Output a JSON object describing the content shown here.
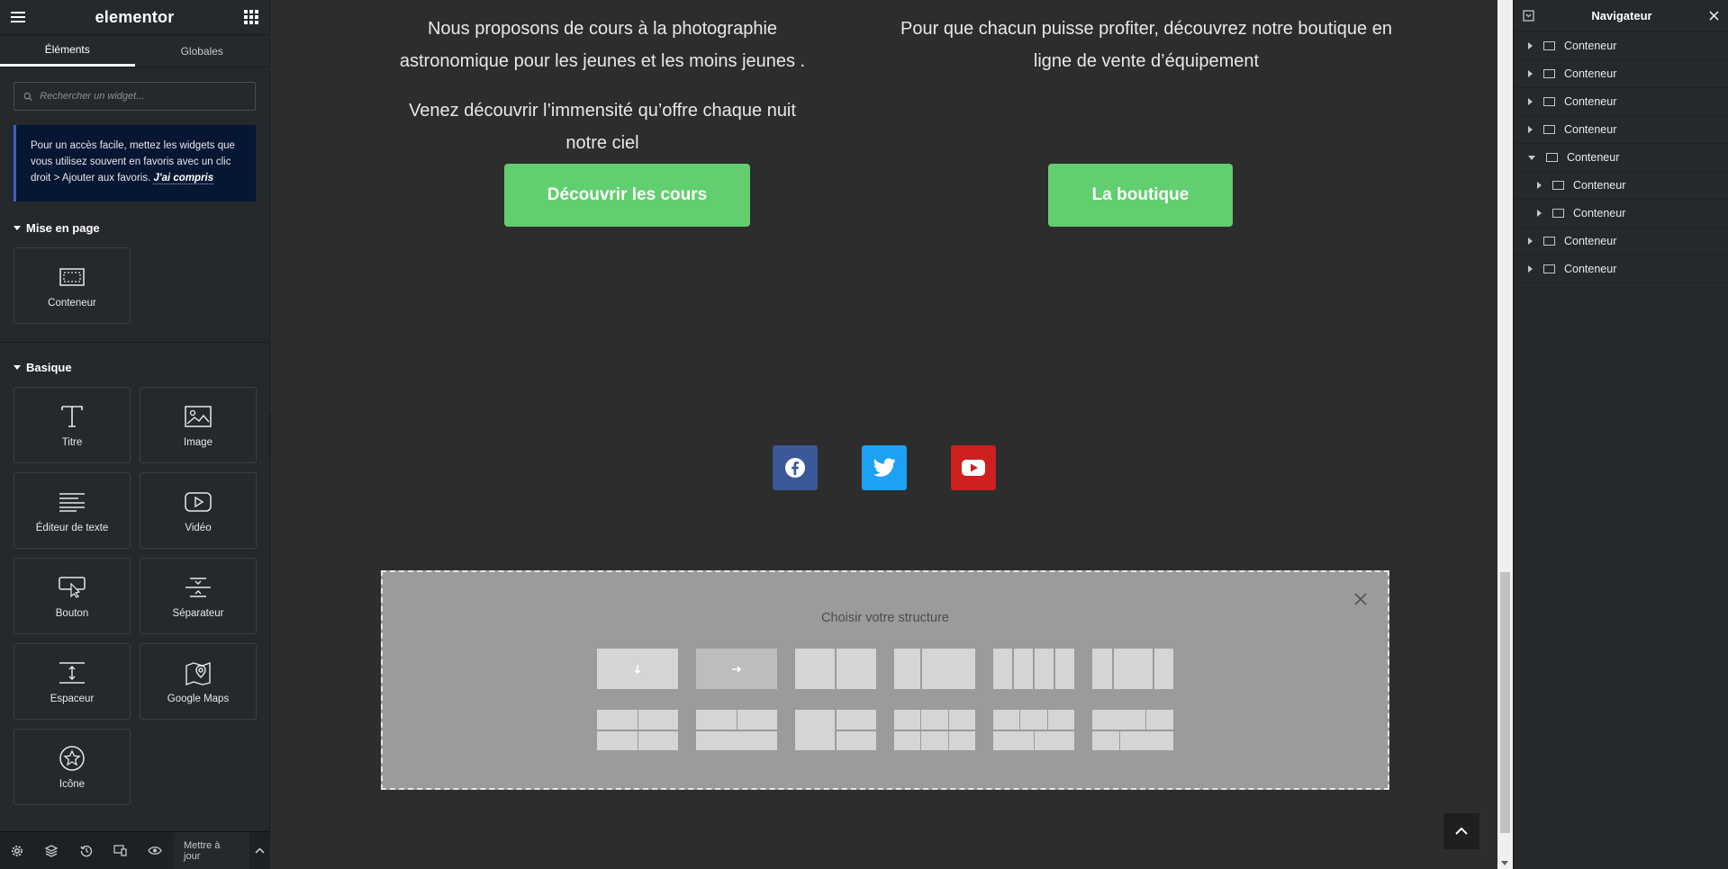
{
  "left_panel": {
    "logo": "elementor",
    "tabs": [
      {
        "label": "Éléments"
      },
      {
        "label": "Globales"
      }
    ],
    "search_placeholder": "Rechercher un widget...",
    "notice_text": "Pour un accès facile, mettez les widgets que vous utilisez souvent en favoris avec un clic droit > Ajouter aux favoris.",
    "notice_link": "J'ai compris",
    "sections": [
      {
        "title": "Mise en page",
        "widgets": [
          {
            "label": "Conteneur",
            "icon": "container-icon"
          }
        ]
      },
      {
        "title": "Basique",
        "widgets": [
          {
            "label": "Titre",
            "icon": "heading-icon"
          },
          {
            "label": "Image",
            "icon": "image-icon"
          },
          {
            "label": "Éditeur de texte",
            "icon": "text-editor-icon"
          },
          {
            "label": "Vidéo",
            "icon": "video-icon"
          },
          {
            "label": "Bouton",
            "icon": "button-icon"
          },
          {
            "label": "Séparateur",
            "icon": "divider-icon"
          },
          {
            "label": "Espaceur",
            "icon": "spacer-icon"
          },
          {
            "label": "Google Maps",
            "icon": "google-maps-icon"
          },
          {
            "label": "Icône",
            "icon": "star-icon"
          }
        ]
      }
    ],
    "footer": {
      "update_label": "Mettre à jour"
    }
  },
  "canvas": {
    "left_text_1": "Nous proposons de cours à la photographie astronomique pour les jeunes et les moins jeunes .",
    "left_text_2": "Venez découvrir l’immensité qu’offre chaque nuit notre ciel",
    "right_text": "Pour que chacun puisse profiter, découvrez notre boutique en ligne de vente d’équipement",
    "button_left": "Découvrir les cours",
    "button_right": "La boutique",
    "social": [
      {
        "name": "facebook",
        "color": "#3b5998"
      },
      {
        "name": "twitter",
        "color": "#1da1f2"
      },
      {
        "name": "youtube",
        "color": "#cd201f"
      }
    ],
    "structure_title": "Choisir votre structure",
    "accent_color": "#61ce70"
  },
  "navigator": {
    "title": "Navigateur",
    "items": [
      {
        "label": "Conteneur",
        "expanded": false,
        "depth": 0
      },
      {
        "label": "Conteneur",
        "expanded": false,
        "depth": 0
      },
      {
        "label": "Conteneur",
        "expanded": false,
        "depth": 0
      },
      {
        "label": "Conteneur",
        "expanded": false,
        "depth": 0
      },
      {
        "label": "Conteneur",
        "expanded": true,
        "depth": 0
      },
      {
        "label": "Conteneur",
        "expanded": false,
        "depth": 1
      },
      {
        "label": "Conteneur",
        "expanded": false,
        "depth": 1
      },
      {
        "label": "Conteneur",
        "expanded": false,
        "depth": 0
      },
      {
        "label": "Conteneur",
        "expanded": false,
        "depth": 0
      }
    ]
  }
}
